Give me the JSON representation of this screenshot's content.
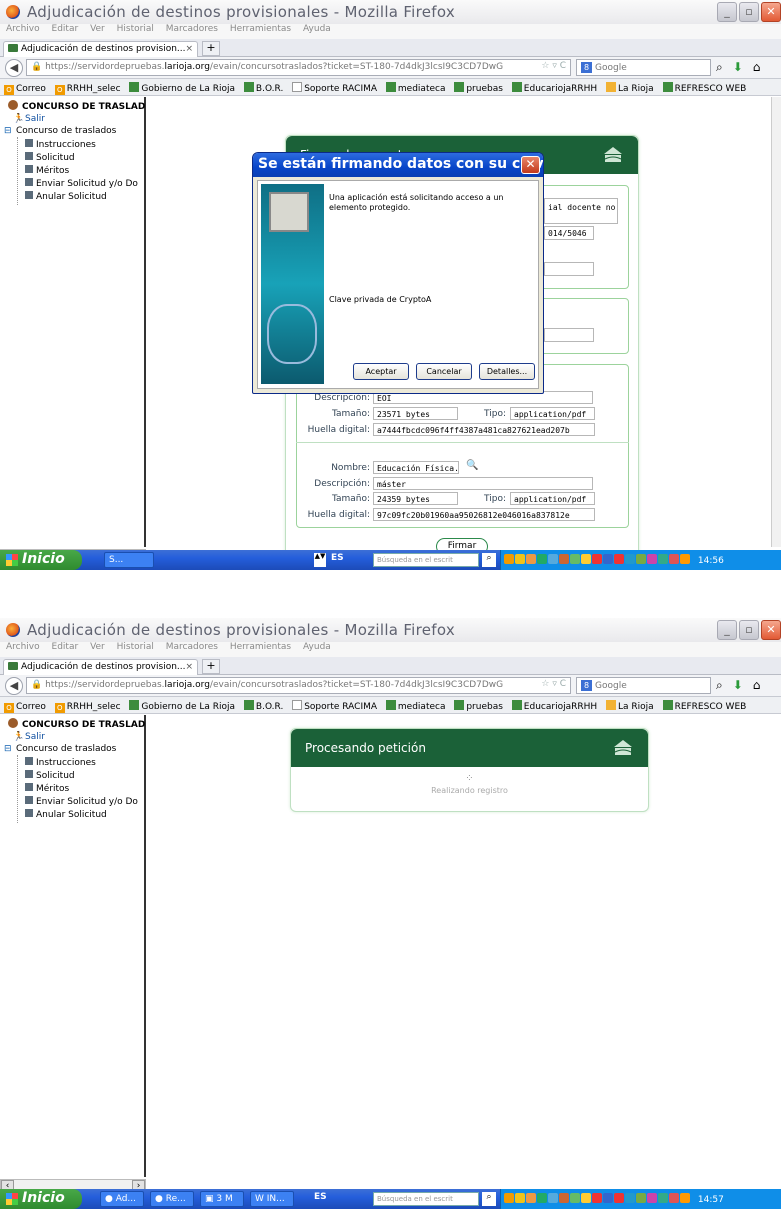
{
  "window": {
    "title": "Adjudicación de destinos provisionales - Mozilla Firefox"
  },
  "menu": [
    "Archivo",
    "Editar",
    "Ver",
    "Historial",
    "Marcadores",
    "Herramientas",
    "Ayuda"
  ],
  "tab": {
    "title": "Adjudicación de destinos provision...",
    "close": "×",
    "new": "+"
  },
  "url": {
    "prefix": "https://servidordepruebas.",
    "domain": "larioja.org",
    "path": "/evain/concursotraslados?ticket=ST-180-7d4dkJ3lcsI9C3CD7DwG",
    "controls": "☆ ▿ C"
  },
  "search": {
    "engine_letter": "8",
    "placeholder": "Google"
  },
  "bookmarks": [
    {
      "label": "Correo",
      "icon": "o"
    },
    {
      "label": "RRHH_selec",
      "icon": "o"
    },
    {
      "label": "Gobierno de La Rioja",
      "icon": "g"
    },
    {
      "label": "B.O.R.",
      "icon": "g"
    },
    {
      "label": "Soporte RACIMA",
      "icon": "e"
    },
    {
      "label": "mediateca",
      "icon": "g"
    },
    {
      "label": "pruebas",
      "icon": "g"
    },
    {
      "label": "EducariojaRRHH",
      "icon": "g"
    },
    {
      "label": "La Rioja",
      "icon": "r"
    },
    {
      "label": "REFRESCO WEB",
      "icon": "g"
    }
  ],
  "sidebar": {
    "heading": "CONCURSO DE TRASLAD",
    "logout": "Salir",
    "folder": "Concurso de traslados",
    "items": [
      "Instrucciones",
      "Solicitud",
      "Méritos",
      "Enviar Solicitud y/o Do",
      "Anular Solicitud"
    ]
  },
  "firmar": {
    "title": "Firmar documentos",
    "partial_text_1": "ial docente no",
    "partial_text_2": "014/5046",
    "doc1": {
      "desc_label": "Descripción:",
      "desc": "EOI",
      "size_label": "Tamaño:",
      "size": "23571 bytes",
      "type_label": "Tipo:",
      "type": "application/pdf",
      "hash_label": "Huella digital:",
      "hash": "a7444fbcdc096f4ff4387a481ca827621ead207b"
    },
    "doc2": {
      "name_label": "Nombre:",
      "name": "Educación Física.pd",
      "desc_label": "Descripción:",
      "desc": "máster",
      "size_label": "Tamaño:",
      "size": "24359 bytes",
      "type_label": "Tipo:",
      "type": "application/pdf",
      "hash_label": "Huella digital:",
      "hash": "97c09fc20b01960aa95026812e046016a837812e"
    },
    "button": "Firmar"
  },
  "dialog": {
    "title": "Se están firmando datos con su clav...",
    "message": "Una aplicación está solicitando acceso a un elemento protegido.",
    "key": "Clave privada de CryptoA",
    "accept": "Aceptar",
    "cancel": "Cancelar",
    "details": "Detalles..."
  },
  "processing": {
    "title": "Procesando petición",
    "status": "Realizando registro"
  },
  "taskbar": {
    "start": "Inicio",
    "lang": "ES",
    "search_placeholder": "Búsqueda en el escrit",
    "shot1_task": "S...",
    "shot1_time": "14:56",
    "shot2_tasks": [
      "Ad...",
      "Re...",
      "3 M",
      "IN..."
    ],
    "shot2_time": "14:57"
  }
}
